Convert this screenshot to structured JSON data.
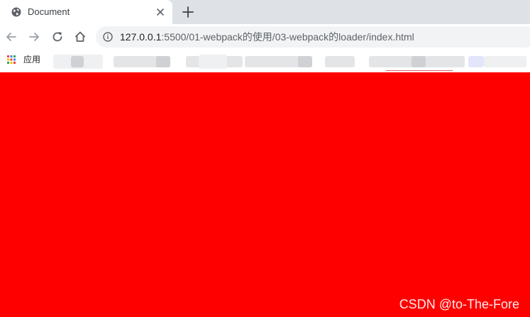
{
  "browser": {
    "tab": {
      "title": "Document",
      "favicon": "globe-icon"
    },
    "new_tab_icon": "plus-icon",
    "toolbar": {
      "back_icon": "arrow-left-icon",
      "forward_icon": "arrow-right-icon",
      "reload_icon": "reload-icon",
      "home_icon": "home-icon"
    },
    "address_bar": {
      "info_icon": "info-icon",
      "host": "127.0.0.1",
      "path": ":5500/01-webpack的使用/03-webpack的loader/index.html"
    },
    "bookmarks": {
      "apps_label": "应用",
      "apps_icon": "apps-grid-icon"
    }
  },
  "page": {
    "background_color": "#ff0000"
  },
  "watermark": "CSDN @to-The-Fore",
  "colors": {
    "tab_strip": "#dee1e6",
    "omnibox": "#f1f3f4",
    "page_bg": "#ff0000"
  }
}
